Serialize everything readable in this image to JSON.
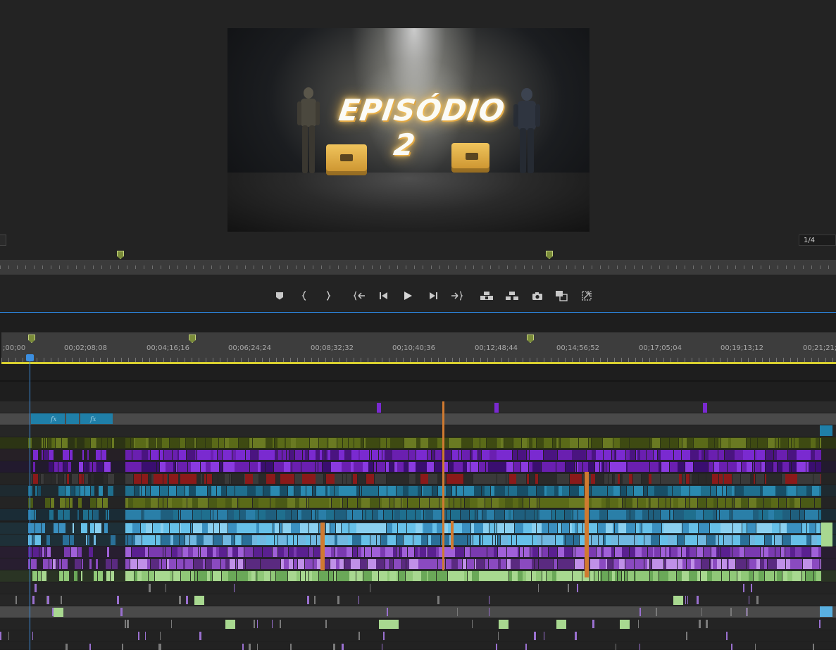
{
  "program_monitor": {
    "video_title": "EPISÓDIO 2",
    "zoom": "1/4"
  },
  "transport_buttons": [
    {
      "name": "add-marker",
      "icon": "marker-icon"
    },
    {
      "name": "mark-in",
      "icon": "mark-in-icon"
    },
    {
      "name": "mark-out",
      "icon": "mark-out-icon"
    },
    {
      "name": "go-to-in",
      "icon": "go-to-in-icon"
    },
    {
      "name": "step-back",
      "icon": "step-back-icon"
    },
    {
      "name": "play",
      "icon": "play-icon"
    },
    {
      "name": "step-forward",
      "icon": "step-forward-icon"
    },
    {
      "name": "go-to-out",
      "icon": "go-to-out-icon"
    },
    {
      "name": "lift",
      "icon": "lift-icon"
    },
    {
      "name": "extract",
      "icon": "extract-icon"
    },
    {
      "name": "export-frame",
      "icon": "camera-icon"
    },
    {
      "name": "comparison-view",
      "icon": "comparison-view-icon"
    },
    {
      "name": "toggle-proxies",
      "icon": "proxy-toggle-icon"
    }
  ],
  "timeline": {
    "timecodes": [
      ";00;00",
      "00;02;08;08",
      "00;04;16;16",
      "00;06;24;24",
      "00;08;32;32",
      "00;10;40;36",
      "00;12;48;44",
      "00;14;56;52",
      "00;17;05;04",
      "00;19;13;12",
      "00;21;21;"
    ],
    "fx_badges": [
      "fx",
      "fx"
    ],
    "colors": {
      "playhead": "#3c8fe0",
      "work_area": "#d8d030",
      "clip_purple": "#6a1fb0",
      "clip_olive": "#5a6a18",
      "clip_teal": "#1f6f8e",
      "clip_lightblue": "#66c0e8",
      "clip_green": "#a8d890",
      "clip_orange": "#d07a30"
    }
  }
}
